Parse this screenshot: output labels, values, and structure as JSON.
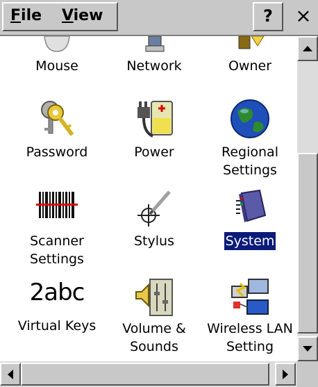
{
  "menubar": {
    "file_label": "File",
    "file_mnemonic": "F",
    "file_rest": "ile",
    "view_label": "View",
    "view_mnemonic": "V",
    "view_rest": "iew",
    "help_label": "?",
    "close_label": "×"
  },
  "items": [
    {
      "label": "Mouse",
      "icon": "mouse-icon"
    },
    {
      "label": "Network",
      "icon": "network-icon"
    },
    {
      "label": "Owner",
      "icon": "owner-icon"
    },
    {
      "label": "Password",
      "icon": "keys-icon"
    },
    {
      "label": "Power",
      "icon": "power-plug-battery-icon"
    },
    {
      "label_line1": "Regional",
      "label_line2": "Settings",
      "icon": "globe-icon"
    },
    {
      "label_line1": "Scanner",
      "label_line2": "Settings",
      "icon": "barcode-icon"
    },
    {
      "label": "Stylus",
      "icon": "stylus-crosshair-icon"
    },
    {
      "label": "System",
      "icon": "system-chip-icon",
      "selected": true
    },
    {
      "label": "Virtual Keys",
      "icon": "2abc-icon",
      "icon_text": "2abc"
    },
    {
      "label_line1": "Volume &",
      "label_line2": "Sounds",
      "icon": "speaker-icon"
    },
    {
      "label_line1": "Wireless LAN",
      "label_line2": "Setting",
      "icon": "wireless-lan-icon"
    }
  ],
  "colors": {
    "chrome": "#c8c8c8",
    "selection": "#0a1b7a"
  }
}
